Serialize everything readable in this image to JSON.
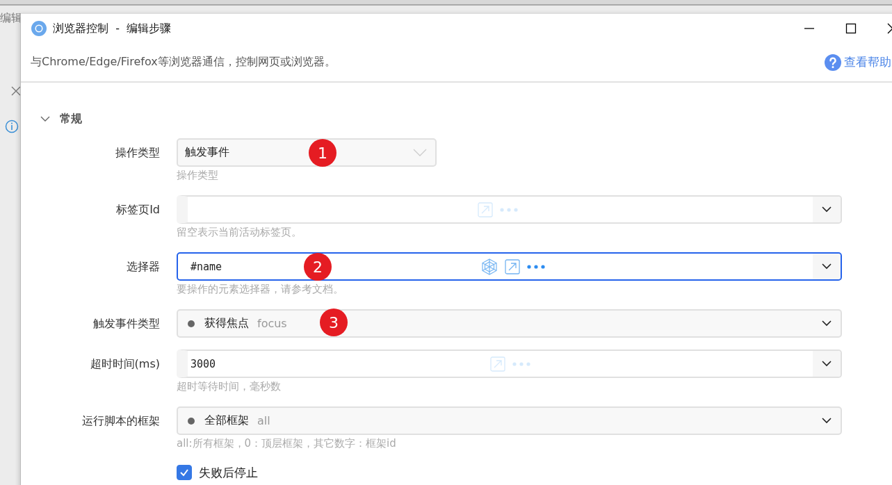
{
  "background_window": {
    "title": "编辑"
  },
  "window": {
    "title": "浏览器控制  -  编辑步骤"
  },
  "description": "与Chrome/Edge/Firefox等浏览器通信，控制网页或浏览器。",
  "help_link": "查看帮助",
  "section": {
    "title": "常规",
    "expanded": true
  },
  "fields": [
    {
      "kind": "select",
      "label": "操作类型",
      "value": "触发事件",
      "hint": "操作类型",
      "badge": "1"
    },
    {
      "kind": "input",
      "label": "标签页Id",
      "focused": false,
      "hint": "留空表示当前活动标签页。"
    },
    {
      "kind": "input",
      "label": "选择器",
      "value": "#name",
      "focused": true,
      "hint": "要操作的元素选择器，请参考文档。",
      "badge": "2"
    },
    {
      "kind": "option",
      "label": "触发事件类型",
      "value": "获得焦点",
      "code": "focus",
      "badge": "3"
    },
    {
      "kind": "input",
      "label": "超时时间(ms)",
      "value": "3000",
      "focused": false,
      "hint": "超时等待时间，毫秒数"
    },
    {
      "kind": "option",
      "label": "运行脚本的框架",
      "value": "全部框架",
      "code": "all",
      "hint": "all:所有框架，0：顶层框架，其它数字：框架id"
    },
    {
      "kind": "checkbox",
      "label": "失败后停止",
      "checked": true
    }
  ]
}
